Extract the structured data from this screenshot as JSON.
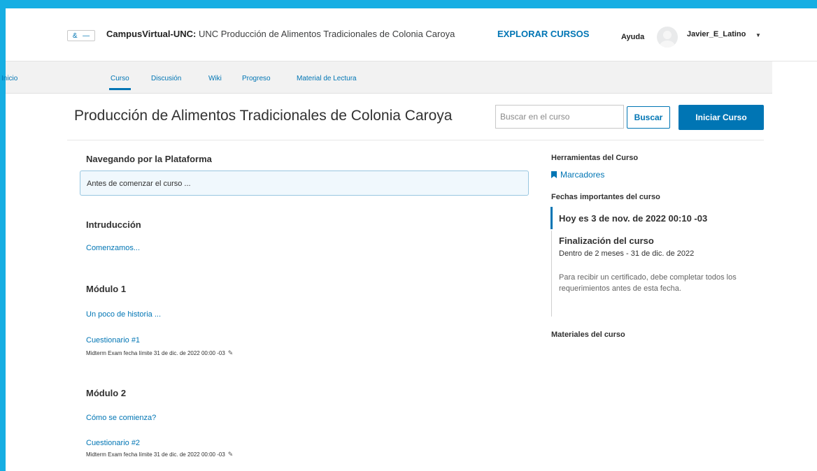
{
  "header": {
    "logo_left": "&",
    "logo_right": "—",
    "site_name": "CampusVirtual-UNC:",
    "course_name": "UNC Producción de Alimentos Tradicionales de Colonia Caroya",
    "explore_label": "EXPLORAR CURSOS",
    "help_label": "Ayuda",
    "username": "Javier_E_Latino",
    "user_menu_icon": "caret-down-icon"
  },
  "course_nav": {
    "items": [
      {
        "label": "Inicio",
        "active": false
      },
      {
        "label": "Curso",
        "active": true
      },
      {
        "label": "Discusión",
        "active": false
      },
      {
        "label": "Wiki",
        "active": false
      },
      {
        "label": "Progreso",
        "active": false
      },
      {
        "label": "Material de Lectura",
        "active": false
      }
    ]
  },
  "title_bar": {
    "title": "Producción de Alimentos Tradicionales de Colonia Caroya",
    "search_placeholder": "Buscar en el curso",
    "search_button": "Buscar",
    "start_button": "Iniciar Curso"
  },
  "outline": {
    "sections": [
      {
        "title": "Navegando por la Plataforma",
        "items": [
          {
            "label": "Antes de comenzar el curso ...",
            "highlighted": true
          }
        ]
      },
      {
        "title": "Intruducción",
        "items": [
          {
            "label": "Comenzamos..."
          }
        ]
      },
      {
        "title": "Módulo 1",
        "items": [
          {
            "label": "Un poco de historia ..."
          },
          {
            "label": "Cuestionario #1",
            "due": "Midterm Exam fecha límite 31 de dic. de 2022 00:00 -03"
          }
        ]
      },
      {
        "title": "Módulo 2",
        "items": [
          {
            "label": "Cómo se comienza?"
          },
          {
            "label": "Cuestionario #2",
            "due": "Midterm Exam fecha límite 31 de dic. de 2022 00:00 -03"
          }
        ]
      }
    ]
  },
  "sidebar": {
    "tools_heading": "Herramientas del Curso",
    "bookmarks_label": "Marcadores",
    "dates_heading": "Fechas importantes del curso",
    "today_label": "Hoy es 3 de nov. de 2022 00:10 -03",
    "event_title": "Finalización del curso",
    "event_when": "Dentro de 2 meses - 31 de dic. de 2022",
    "event_description": "Para recibir un certificado, debe completar todos los requerimientos antes de esta fecha.",
    "materials_heading": "Materiales del curso"
  },
  "colors": {
    "frame": "#16aee3",
    "primary": "#0075b4",
    "text": "#313131"
  }
}
